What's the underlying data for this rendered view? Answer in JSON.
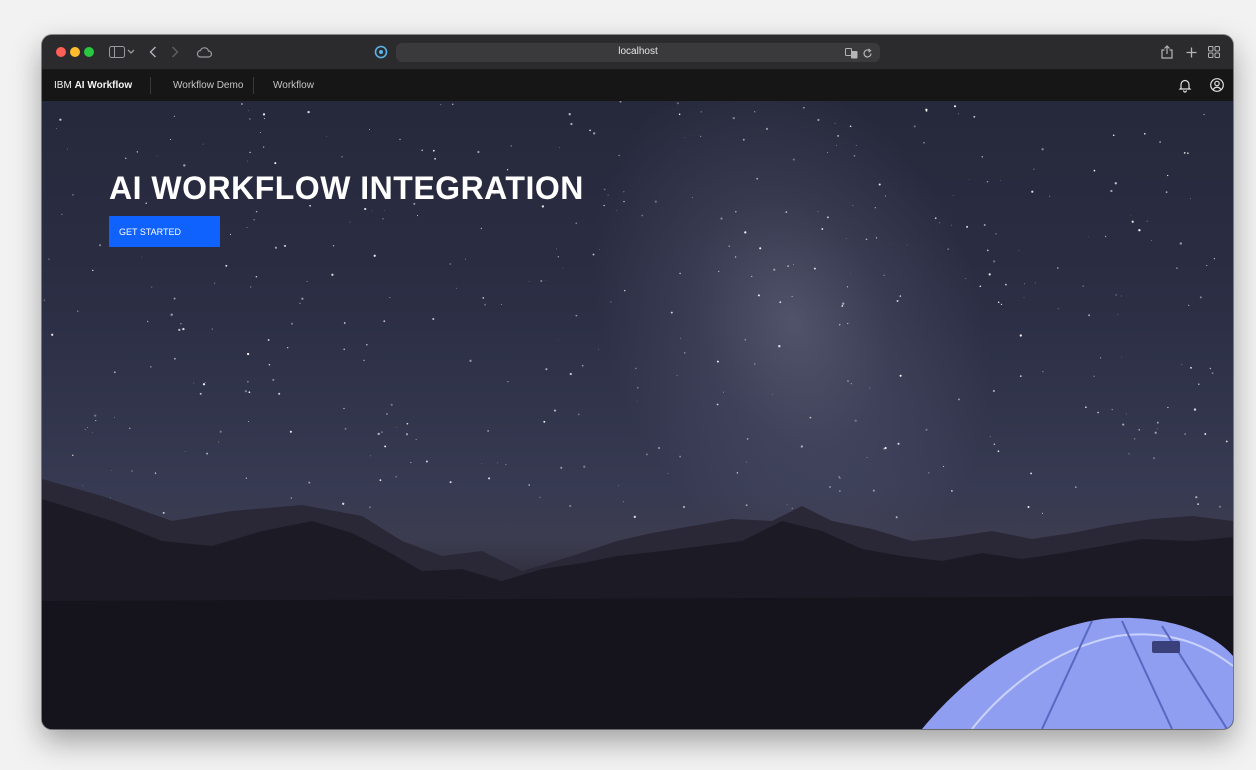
{
  "browser": {
    "address": "localhost"
  },
  "header": {
    "brand_prefix": "IBM",
    "brand_name": "AI Workflow",
    "nav": [
      {
        "label": "Workflow Demo"
      },
      {
        "label": "Workflow"
      }
    ],
    "icons": [
      "notification-icon",
      "user-avatar-icon"
    ]
  },
  "hero": {
    "title": "AI WORKFLOW INTEGRATION",
    "cta_label": "GET STARTED"
  },
  "colors": {
    "accent": "#0f62fe",
    "header_bg": "#161616",
    "toolbar_bg": "#2b2b2e"
  }
}
